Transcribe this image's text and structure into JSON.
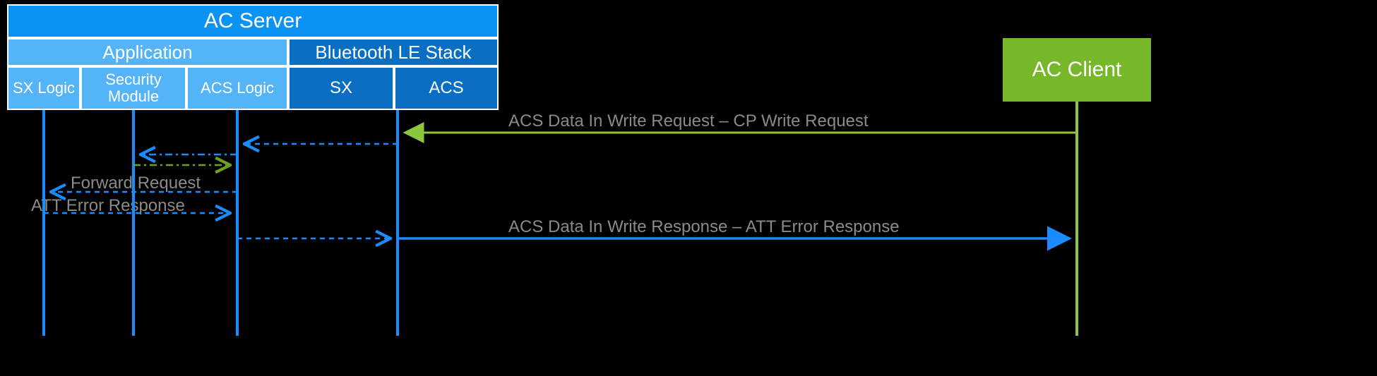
{
  "server": {
    "title": "AC Server",
    "application_label": "Application",
    "ble_stack_label": "Bluetooth LE Stack",
    "cells": {
      "sx_logic": "SX Logic",
      "security_module": "Security Module",
      "acs_logic": "ACS Logic",
      "sx": "SX",
      "acs": "ACS"
    }
  },
  "client": {
    "label": "AC Client"
  },
  "messages": {
    "req_in": "ACS Data In Write Request – CP Write Request",
    "forward_req": "Forward Request",
    "att_err": "ATT Error Response",
    "resp_out": "ACS Data In Write Response – ATT Error Response"
  }
}
